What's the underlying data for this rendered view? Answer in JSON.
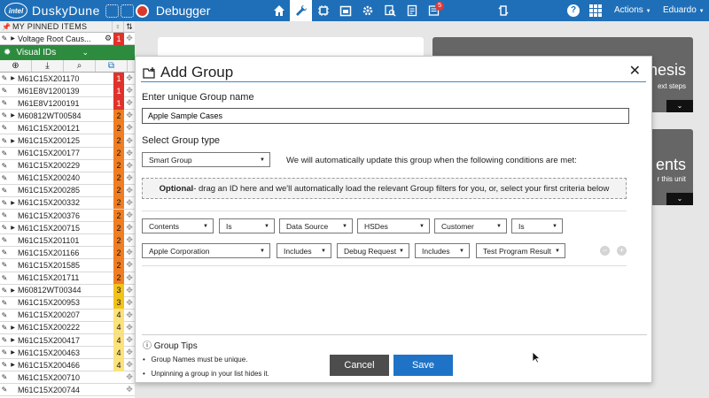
{
  "header": {
    "logo": "intel",
    "app_name": "DuskyDune",
    "section": "Debugger",
    "actions_label": "Actions",
    "user_label": "Eduardo",
    "notifications_count": "5",
    "help_label": "?"
  },
  "pinned": {
    "title": "MY PINNED ITEMS",
    "items": [
      {
        "label": "Voltage Root Caus...",
        "priority": "1"
      }
    ]
  },
  "visual_ids": {
    "title": "Visual IDs",
    "rows": [
      {
        "id": "M61C15X201170",
        "priority": "1",
        "expandable": true
      },
      {
        "id": "M61E8V1200139",
        "priority": "1",
        "expandable": false
      },
      {
        "id": "M61E8V1200191",
        "priority": "1",
        "expandable": false
      },
      {
        "id": "M60812WT00584",
        "priority": "2",
        "expandable": true
      },
      {
        "id": "M61C15X200121",
        "priority": "2",
        "expandable": false
      },
      {
        "id": "M61C15X200125",
        "priority": "2",
        "expandable": true
      },
      {
        "id": "M61C15X200177",
        "priority": "2",
        "expandable": false
      },
      {
        "id": "M61C15X200229",
        "priority": "2",
        "expandable": false
      },
      {
        "id": "M61C15X200240",
        "priority": "2",
        "expandable": false
      },
      {
        "id": "M61C15X200285",
        "priority": "2",
        "expandable": false
      },
      {
        "id": "M61C15X200332",
        "priority": "2",
        "expandable": true
      },
      {
        "id": "M61C15X200376",
        "priority": "2",
        "expandable": false
      },
      {
        "id": "M61C15X200715",
        "priority": "2",
        "expandable": true
      },
      {
        "id": "M61C15X201101",
        "priority": "2",
        "expandable": false
      },
      {
        "id": "M61C15X201166",
        "priority": "2",
        "expandable": false
      },
      {
        "id": "M61C15X201585",
        "priority": "2",
        "expandable": false
      },
      {
        "id": "M61C15X201711",
        "priority": "2",
        "expandable": false
      },
      {
        "id": "M60812WT00344",
        "priority": "3",
        "expandable": true
      },
      {
        "id": "M61C15X200953",
        "priority": "3",
        "expandable": false
      },
      {
        "id": "M61C15X200207",
        "priority": "4",
        "expandable": false
      },
      {
        "id": "M61C15X200222",
        "priority": "4",
        "expandable": true
      },
      {
        "id": "M61C15X200417",
        "priority": "4",
        "expandable": true
      },
      {
        "id": "M61C15X200463",
        "priority": "4",
        "expandable": true
      },
      {
        "id": "M61C15X200466",
        "priority": "4",
        "expandable": true
      },
      {
        "id": "M61C15X200710",
        "priority": "",
        "expandable": false
      },
      {
        "id": "M61C15X200744",
        "priority": "",
        "expandable": false
      }
    ]
  },
  "cards": {
    "right_top_big": "nesis",
    "right_top_small": "ext steps",
    "right_mid_big": "ents",
    "right_mid_small": "r this unit"
  },
  "modal": {
    "title": "Add Group",
    "name_label": "Enter unique Group name",
    "name_value": "Apple Sample Cases",
    "type_label": "Select Group type",
    "type_value": "Smart Group",
    "auto_note": "We will automatically update this group when the following conditions are met:",
    "drop_bold": "Optional",
    "drop_text": "- drag an ID here and we'll automatically load the relevant Group filters for you, or, select your first criteria below",
    "criteria_row1": [
      "Contents",
      "Is",
      "Data Source",
      "HSDes",
      "Customer",
      "Is"
    ],
    "criteria_row2": [
      "Apple Corporation",
      "Includes",
      "Debug Request",
      "Includes",
      "Test Program Result"
    ],
    "tips_title": "Group Tips",
    "tips": [
      "Group Names must be unique.",
      "Unpinning a group in your list hides it."
    ],
    "cancel_label": "Cancel",
    "save_label": "Save"
  },
  "colors": {
    "header_bg": "#1f6fb8",
    "green": "#2d8b3e",
    "p1": "#e0322a",
    "p2": "#ef7d22",
    "p3": "#f2c21a",
    "p4": "#fbe27a",
    "save": "#1f73c7",
    "cancel": "#4d4d4d"
  }
}
